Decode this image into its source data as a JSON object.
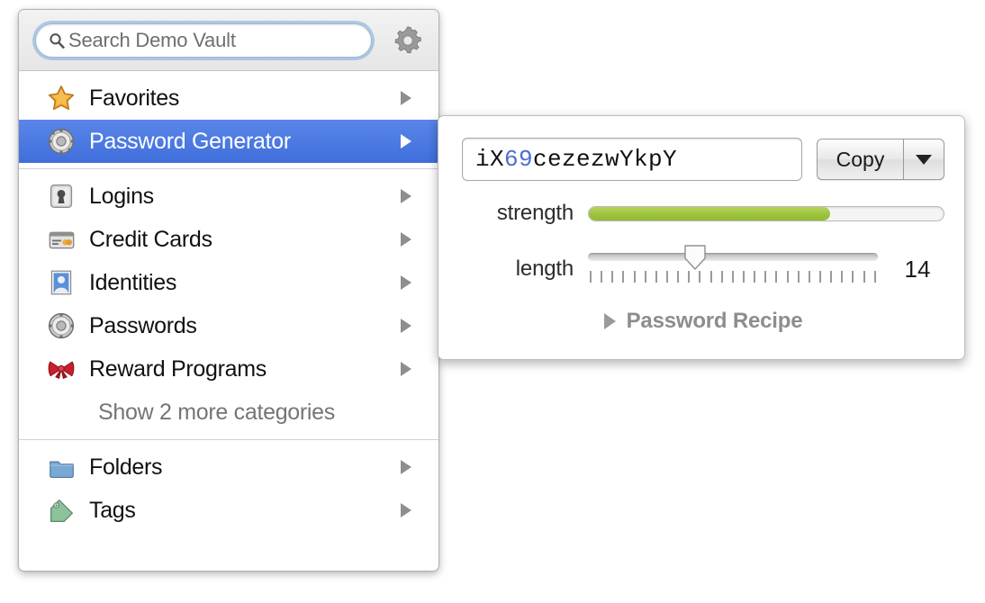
{
  "search": {
    "placeholder": "Search Demo Vault",
    "icon": "search-icon",
    "settings_icon": "gear-icon"
  },
  "sidebar": {
    "groups": [
      {
        "items": [
          {
            "label": "Favorites",
            "icon": "star-icon",
            "selected": false,
            "has_arrow": true
          },
          {
            "label": "Password Generator",
            "icon": "dial-icon",
            "selected": true,
            "has_arrow": true
          }
        ]
      },
      {
        "items": [
          {
            "label": "Logins",
            "icon": "keyhole-icon",
            "selected": false,
            "has_arrow": true
          },
          {
            "label": "Credit Cards",
            "icon": "credit-card-icon",
            "selected": false,
            "has_arrow": true
          },
          {
            "label": "Identities",
            "icon": "person-icon",
            "selected": false,
            "has_arrow": true
          },
          {
            "label": "Passwords",
            "icon": "dial-icon",
            "selected": false,
            "has_arrow": true
          },
          {
            "label": "Reward Programs",
            "icon": "bow-icon",
            "selected": false,
            "has_arrow": true
          },
          {
            "label": "Show 2 more categories",
            "icon": "none",
            "selected": false,
            "has_arrow": false
          }
        ]
      },
      {
        "items": [
          {
            "label": "Folders",
            "icon": "folder-icon",
            "selected": false,
            "has_arrow": true
          },
          {
            "label": "Tags",
            "icon": "tag-icon",
            "selected": false,
            "has_arrow": true
          }
        ]
      }
    ]
  },
  "generator": {
    "password": {
      "full": "iX69cezezwYkpY",
      "segments": [
        {
          "text": "iX",
          "kind": "letter"
        },
        {
          "text": "69",
          "kind": "digit"
        },
        {
          "text": "cezezwYkpY",
          "kind": "letter"
        }
      ]
    },
    "copy_label": "Copy",
    "copy_menu_icon": "caret-down-icon",
    "strength": {
      "label": "strength",
      "percent": 68
    },
    "length": {
      "label": "length",
      "value": "14",
      "thumb_percent": 37,
      "tick_count": 27
    },
    "recipe": {
      "label": "Password Recipe",
      "disclosure_icon": "disclosure-triangle-icon",
      "expanded": false
    }
  },
  "colors": {
    "selection_blue": "#4b7ae0",
    "strength_green": "#9cc33e",
    "digit_blue": "#4a6fd0",
    "muted_text": "#757575"
  }
}
